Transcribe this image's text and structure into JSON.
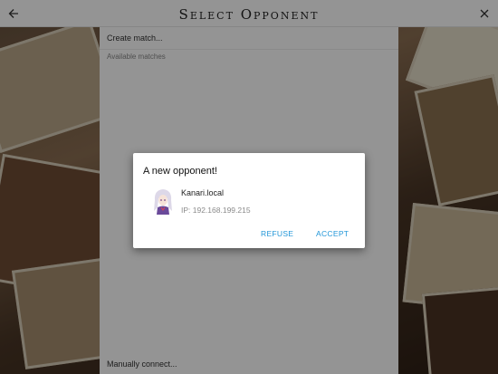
{
  "header": {
    "title": "Select Opponent",
    "back_icon": "arrow-left-icon",
    "close_icon": "close-icon"
  },
  "panel": {
    "create_match": "Create match...",
    "available_matches": "Available matches",
    "manual_connect": "Manually connect..."
  },
  "dialog": {
    "title": "A new opponent!",
    "name": "Kanari.local",
    "ip": "IP: 192.168.199.215",
    "refuse_label": "REFUSE",
    "accept_label": "ACCEPT",
    "accent_color": "#2196d8"
  }
}
